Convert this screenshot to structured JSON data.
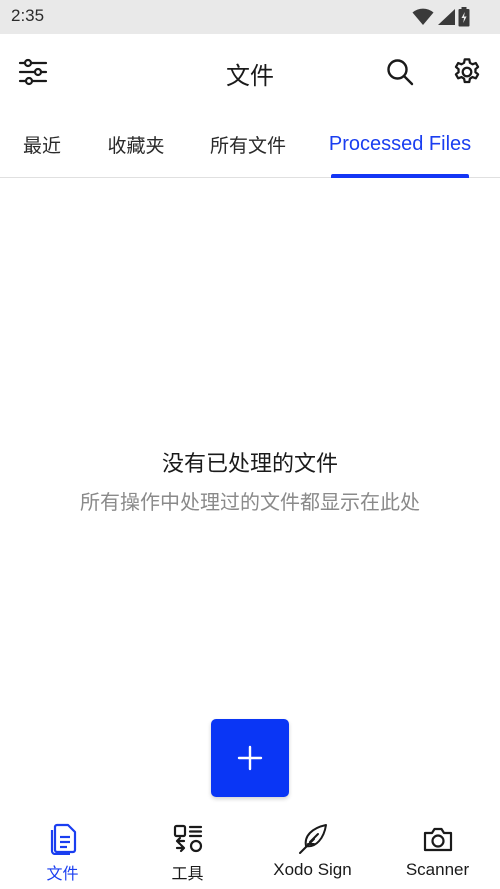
{
  "status_bar": {
    "time": "2:35"
  },
  "app_bar": {
    "title": "文件"
  },
  "tabs": [
    {
      "label": "最近"
    },
    {
      "label": "收藏夹"
    },
    {
      "label": "所有文件"
    },
    {
      "label": "Processed Files",
      "active": true
    }
  ],
  "empty_state": {
    "title": "没有已处理的文件",
    "subtitle": "所有操作中处理过的文件都显示在此处"
  },
  "bottom_nav": [
    {
      "label": "文件",
      "icon": "file-icon",
      "active": true
    },
    {
      "label": "工具",
      "icon": "tools-icon"
    },
    {
      "label": "Xodo Sign",
      "icon": "feather-pen-icon"
    },
    {
      "label": "Scanner",
      "icon": "camera-icon"
    }
  ],
  "colors": {
    "accent": "#1436f5",
    "fab": "#0a36f5",
    "status_bar_bg": "#e9e9e9",
    "muted_text": "#8a8a8a"
  }
}
